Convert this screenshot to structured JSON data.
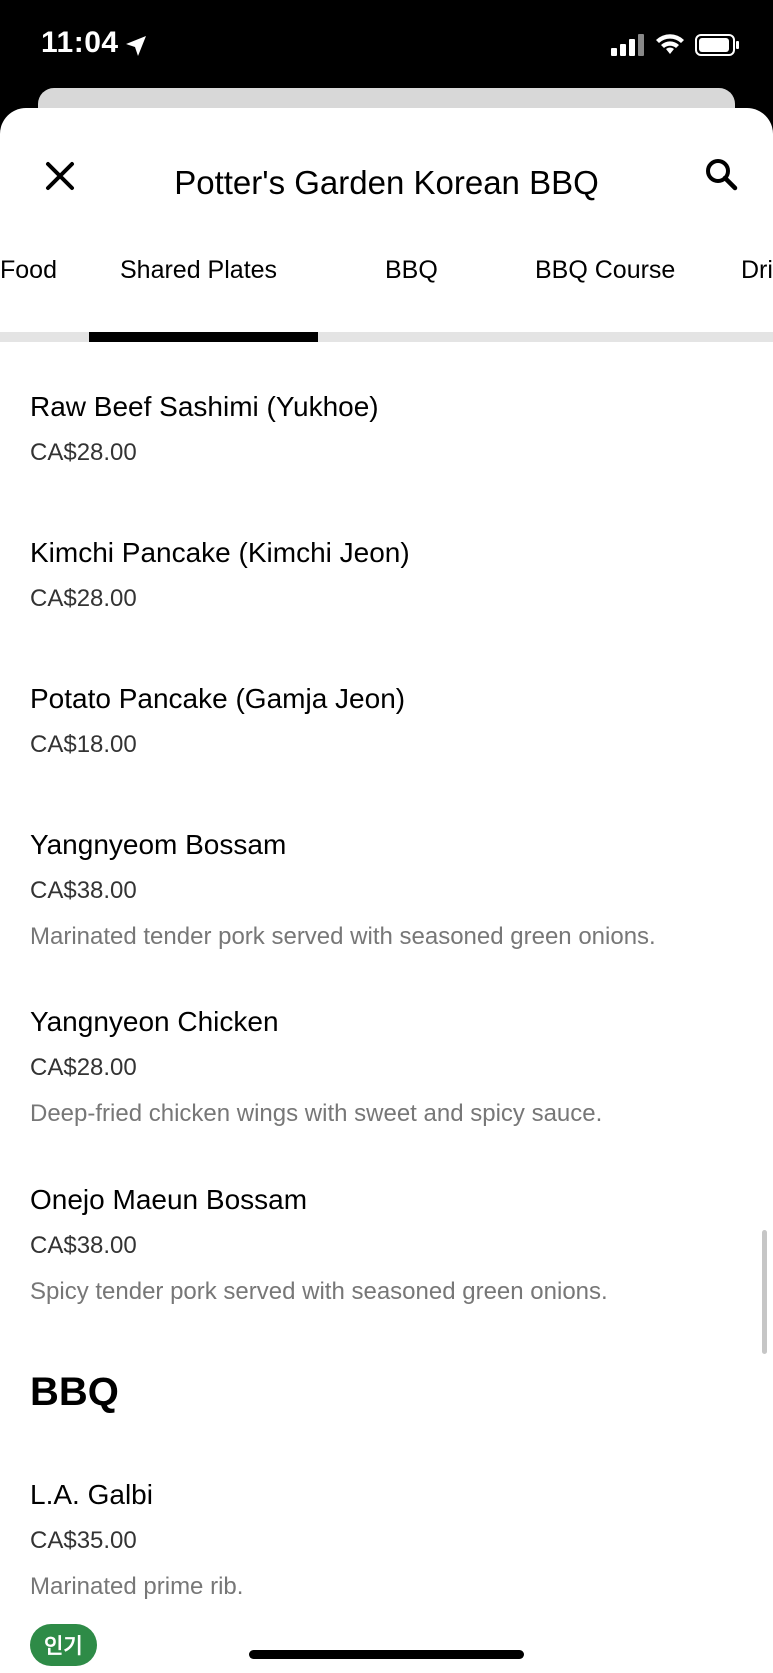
{
  "status": {
    "time": "11:04"
  },
  "header": {
    "title": "Potter's Garden Korean BBQ"
  },
  "tabs": [
    {
      "label": "Food"
    },
    {
      "label": "Shared Plates",
      "active": true
    },
    {
      "label": "BBQ"
    },
    {
      "label": "BBQ Course"
    },
    {
      "label": "Dri"
    }
  ],
  "menu": {
    "items": [
      {
        "name": "Raw Beef Sashimi (Yukhoe)",
        "price": "CA$28.00"
      },
      {
        "name": "Kimchi Pancake (Kimchi Jeon)",
        "price": "CA$28.00"
      },
      {
        "name": "Potato Pancake (Gamja Jeon)",
        "price": "CA$18.00"
      },
      {
        "name": "Yangnyeom Bossam",
        "price": "CA$38.00",
        "description": "Marinated tender pork served with seasoned green onions."
      },
      {
        "name": "Yangnyeon Chicken",
        "price": "CA$28.00",
        "description": "Deep-fried chicken wings with sweet and spicy sauce."
      },
      {
        "name": "Onejo Maeun Bossam",
        "price": "CA$38.00",
        "description": "Spicy tender pork served with seasoned green onions."
      }
    ],
    "bbq_heading": "BBQ",
    "bbq_items": [
      {
        "name": "L.A. Galbi",
        "price": "CA$35.00",
        "description": "Marinated prime rib.",
        "badge": "인기"
      }
    ]
  },
  "colors": {
    "badge_green": "#2e8b47",
    "active_tab": "#000000",
    "muted_text": "#777777"
  },
  "icons": [
    "close-icon",
    "search-icon",
    "location-arrow-icon",
    "signal-icon",
    "wifi-icon",
    "battery-icon"
  ]
}
